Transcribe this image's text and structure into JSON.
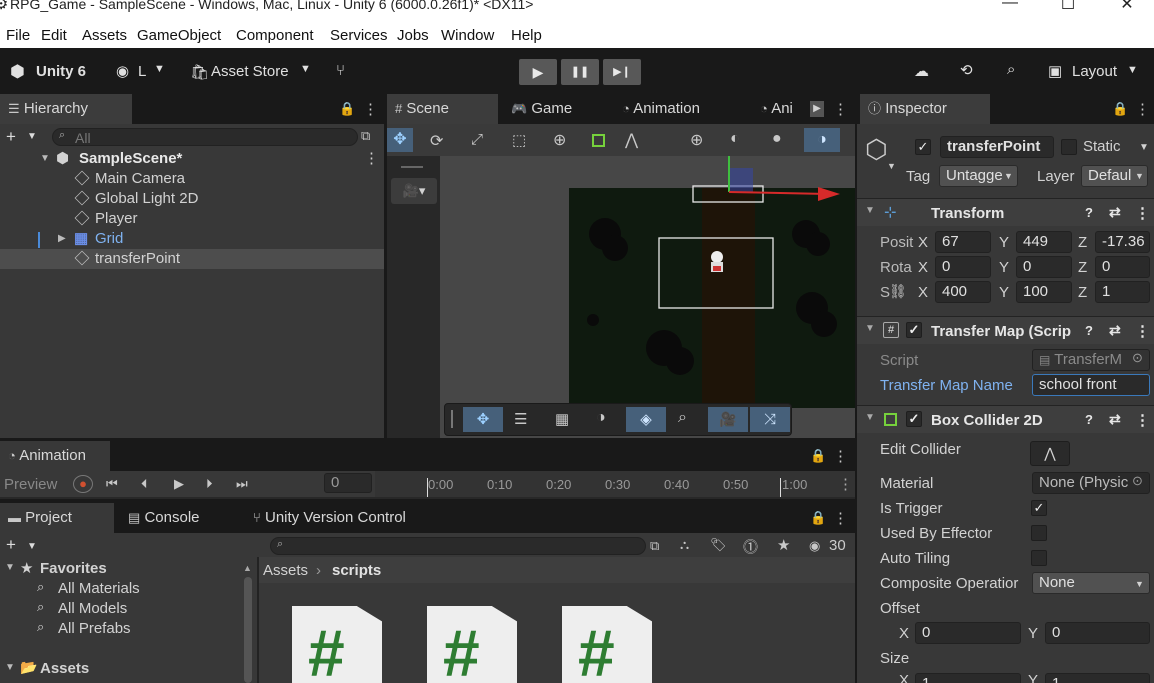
{
  "window": {
    "title": "RPG_Game - SampleScene - Windows, Mac, Linux - Unity 6 (6000.0.26f1)* <DX11>",
    "minimize": "—",
    "maximize": "☐",
    "close": "✕"
  },
  "menu": [
    "File",
    "Edit",
    "Assets",
    "GameObject",
    "Component",
    "Services",
    "Jobs",
    "Window",
    "Help"
  ],
  "toolbar": {
    "unity": "Unity 6",
    "account": "L",
    "asset_store": "Asset Store",
    "layout": "Layout",
    "icons": [
      "unity-logo-icon",
      "account-icon",
      "asset-store-icon",
      "version-control-icon",
      "cloud-icon",
      "history-icon",
      "search-icon",
      "layout-icon"
    ]
  },
  "playmode": {
    "play": "▶",
    "pause": "❚❚",
    "step": "▶❙"
  },
  "hierarchy": {
    "tab": "Hierarchy",
    "search_placeholder": "All",
    "scene": "SampleScene*",
    "items": [
      "Main Camera",
      "Global Light 2D",
      "Player",
      "Grid",
      "transferPoint"
    ],
    "selected": "transferPoint"
  },
  "scene_tabs": [
    "Scene",
    "Game",
    "Animation",
    "Ani"
  ],
  "inspector": {
    "tab": "Inspector",
    "object_name": "transferPoint",
    "static_label": "Static",
    "tag_label": "Tag",
    "tag_value": "Untagge",
    "layer_label": "Layer",
    "layer_value": "Defaul",
    "transform": {
      "title": "Transform",
      "pos_label": "Posit",
      "rot_label": "Rota",
      "scale_label": "S",
      "x": "X",
      "y": "Y",
      "z": "Z",
      "pos": [
        "67",
        "449",
        "-17.36"
      ],
      "rot": [
        "0",
        "0",
        "0"
      ],
      "scale": [
        "400",
        "100",
        "1"
      ]
    },
    "transfer_map": {
      "title": "Transfer Map (Scrip",
      "script_label": "Script",
      "script_value": "TransferM",
      "map_name_label": "Transfer Map Name",
      "map_name_value": "school front"
    },
    "box_collider": {
      "title": "Box Collider 2D",
      "edit_collider": "Edit Collider",
      "material_label": "Material",
      "material_value": "None (Physic",
      "is_trigger": "Is Trigger",
      "is_trigger_checked": true,
      "used_by_effector": "Used By Effector",
      "auto_tiling": "Auto Tiling",
      "composite_label": "Composite Operatior",
      "composite_value": "None",
      "offset_label": "Offset",
      "offset_x": "0",
      "offset_y": "0",
      "size_label": "Size",
      "size_x": "1",
      "size_y": "1"
    }
  },
  "animation": {
    "tab": "Animation",
    "preview": "Preview",
    "frame": "0",
    "ticks": [
      "0:00",
      "0:10",
      "0:20",
      "0:30",
      "0:40",
      "0:50",
      "1:00"
    ]
  },
  "project": {
    "tabs": [
      "Project",
      "Console",
      "Unity Version Control"
    ],
    "favorites": "Favorites",
    "fav_items": [
      "All Materials",
      "All Models",
      "All Prefabs"
    ],
    "assets": "Assets",
    "breadcrumb": [
      "Assets",
      "scripts"
    ],
    "count": "30",
    "script_glyph": "#"
  },
  "colors": {
    "accent_blue": "#2c5d87",
    "script_green": "#2e7d32",
    "selection": "#4d4d4d",
    "link_blue": "#7fb2f0"
  }
}
